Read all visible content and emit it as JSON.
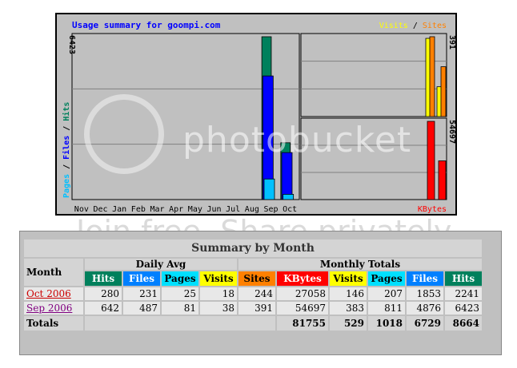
{
  "chart": {
    "title": "Usage summary for goompi.com",
    "left_axis_label_parts": [
      "Pages",
      " / ",
      "Files",
      " / ",
      "Hits"
    ],
    "left_max": "6423",
    "right_top_max": "391",
    "right_bottom_max": "54697",
    "legend_top": [
      "Visits",
      " / ",
      "Sites"
    ],
    "legend_bottom": "KBytes",
    "months": [
      "Nov",
      "Dec",
      "Jan",
      "Feb",
      "Mar",
      "Apr",
      "May",
      "Jun",
      "Jul",
      "Aug",
      "Sep",
      "Oct"
    ],
    "colors": {
      "hits": "#00805c",
      "files": "#0000ff",
      "pages": "#00c0ff",
      "visits": "#ffff00",
      "sites": "#ff8000",
      "kbytes": "#ff0000",
      "title": "#0000ff"
    }
  },
  "chart_data": {
    "type": "bar",
    "categories": [
      "Nov",
      "Dec",
      "Jan",
      "Feb",
      "Mar",
      "Apr",
      "May",
      "Jun",
      "Jul",
      "Aug",
      "Sep",
      "Oct"
    ],
    "main": {
      "ylim": [
        0,
        6423
      ],
      "series": [
        {
          "name": "Hits",
          "values": [
            0,
            0,
            0,
            0,
            0,
            0,
            0,
            0,
            0,
            0,
            6423,
            2241
          ]
        },
        {
          "name": "Files",
          "values": [
            0,
            0,
            0,
            0,
            0,
            0,
            0,
            0,
            0,
            0,
            4876,
            1853
          ]
        },
        {
          "name": "Pages",
          "values": [
            0,
            0,
            0,
            0,
            0,
            0,
            0,
            0,
            0,
            0,
            811,
            207
          ]
        }
      ]
    },
    "visits_sites": {
      "ylim": [
        0,
        391
      ],
      "series": [
        {
          "name": "Visits",
          "values": [
            383,
            146
          ]
        },
        {
          "name": "Sites",
          "values": [
            391,
            244
          ]
        }
      ],
      "categories": [
        "Sep",
        "Oct"
      ]
    },
    "kbytes": {
      "ylim": [
        0,
        54697
      ],
      "series": [
        {
          "name": "KBytes",
          "values": [
            54697,
            27058
          ]
        }
      ],
      "categories": [
        "Sep",
        "Oct"
      ]
    }
  },
  "table": {
    "caption": "Summary by Month",
    "month_header": "Month",
    "daily_avg_header": "Daily Avg",
    "monthly_totals_header": "Monthly Totals",
    "daily_cols": [
      {
        "label": "Hits",
        "bg": "#00805c",
        "fg": "#ffffff"
      },
      {
        "label": "Files",
        "bg": "#0080ff",
        "fg": "#ffffff"
      },
      {
        "label": "Pages",
        "bg": "#00e0ff",
        "fg": "#000000"
      },
      {
        "label": "Visits",
        "bg": "#ffff00",
        "fg": "#000000"
      }
    ],
    "monthly_cols": [
      {
        "label": "Sites",
        "bg": "#ff8000",
        "fg": "#000000"
      },
      {
        "label": "KBytes",
        "bg": "#ff0000",
        "fg": "#ffffff"
      },
      {
        "label": "Visits",
        "bg": "#ffff00",
        "fg": "#000000"
      },
      {
        "label": "Pages",
        "bg": "#00e0ff",
        "fg": "#000000"
      },
      {
        "label": "Files",
        "bg": "#0080ff",
        "fg": "#ffffff"
      },
      {
        "label": "Hits",
        "bg": "#00805c",
        "fg": "#ffffff"
      }
    ],
    "rows": [
      {
        "month": "Oct 2006",
        "link_color": "#cc0000",
        "values": [
          "280",
          "231",
          "25",
          "18",
          "244",
          "27058",
          "146",
          "207",
          "1853",
          "2241"
        ]
      },
      {
        "month": "Sep 2006",
        "link_color": "#800080",
        "values": [
          "642",
          "487",
          "81",
          "38",
          "391",
          "54697",
          "383",
          "811",
          "4876",
          "6423"
        ]
      }
    ],
    "totals_label": "Totals",
    "totals": [
      "",
      "",
      "",
      "",
      "",
      "81755",
      "529",
      "1018",
      "6729",
      "8664"
    ]
  },
  "watermark": {
    "logo": "photobucket",
    "slogan": "Join free. Share privately."
  }
}
